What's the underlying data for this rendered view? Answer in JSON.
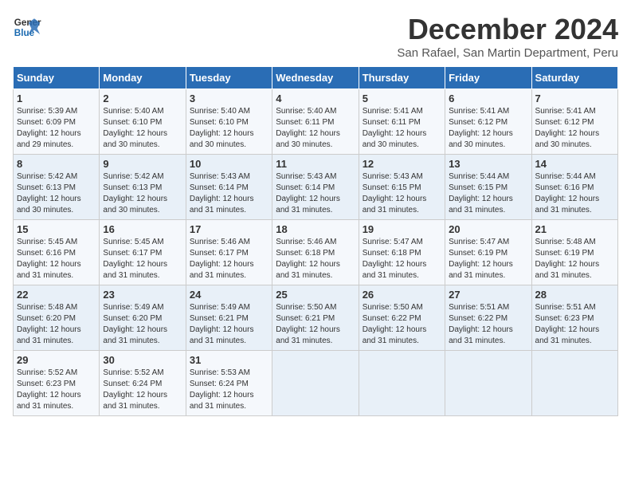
{
  "logo": {
    "line1": "General",
    "line2": "Blue"
  },
  "title": "December 2024",
  "location": "San Rafael, San Martin Department, Peru",
  "weekdays": [
    "Sunday",
    "Monday",
    "Tuesday",
    "Wednesday",
    "Thursday",
    "Friday",
    "Saturday"
  ],
  "weeks": [
    [
      {
        "day": "1",
        "sr": "5:39 AM",
        "ss": "6:09 PM",
        "dh": "12 hours and 29 minutes."
      },
      {
        "day": "2",
        "sr": "5:40 AM",
        "ss": "6:10 PM",
        "dh": "12 hours and 30 minutes."
      },
      {
        "day": "3",
        "sr": "5:40 AM",
        "ss": "6:10 PM",
        "dh": "12 hours and 30 minutes."
      },
      {
        "day": "4",
        "sr": "5:40 AM",
        "ss": "6:11 PM",
        "dh": "12 hours and 30 minutes."
      },
      {
        "day": "5",
        "sr": "5:41 AM",
        "ss": "6:11 PM",
        "dh": "12 hours and 30 minutes."
      },
      {
        "day": "6",
        "sr": "5:41 AM",
        "ss": "6:12 PM",
        "dh": "12 hours and 30 minutes."
      },
      {
        "day": "7",
        "sr": "5:41 AM",
        "ss": "6:12 PM",
        "dh": "12 hours and 30 minutes."
      }
    ],
    [
      {
        "day": "8",
        "sr": "5:42 AM",
        "ss": "6:13 PM",
        "dh": "12 hours and 30 minutes."
      },
      {
        "day": "9",
        "sr": "5:42 AM",
        "ss": "6:13 PM",
        "dh": "12 hours and 30 minutes."
      },
      {
        "day": "10",
        "sr": "5:43 AM",
        "ss": "6:14 PM",
        "dh": "12 hours and 31 minutes."
      },
      {
        "day": "11",
        "sr": "5:43 AM",
        "ss": "6:14 PM",
        "dh": "12 hours and 31 minutes."
      },
      {
        "day": "12",
        "sr": "5:43 AM",
        "ss": "6:15 PM",
        "dh": "12 hours and 31 minutes."
      },
      {
        "day": "13",
        "sr": "5:44 AM",
        "ss": "6:15 PM",
        "dh": "12 hours and 31 minutes."
      },
      {
        "day": "14",
        "sr": "5:44 AM",
        "ss": "6:16 PM",
        "dh": "12 hours and 31 minutes."
      }
    ],
    [
      {
        "day": "15",
        "sr": "5:45 AM",
        "ss": "6:16 PM",
        "dh": "12 hours and 31 minutes."
      },
      {
        "day": "16",
        "sr": "5:45 AM",
        "ss": "6:17 PM",
        "dh": "12 hours and 31 minutes."
      },
      {
        "day": "17",
        "sr": "5:46 AM",
        "ss": "6:17 PM",
        "dh": "12 hours and 31 minutes."
      },
      {
        "day": "18",
        "sr": "5:46 AM",
        "ss": "6:18 PM",
        "dh": "12 hours and 31 minutes."
      },
      {
        "day": "19",
        "sr": "5:47 AM",
        "ss": "6:18 PM",
        "dh": "12 hours and 31 minutes."
      },
      {
        "day": "20",
        "sr": "5:47 AM",
        "ss": "6:19 PM",
        "dh": "12 hours and 31 minutes."
      },
      {
        "day": "21",
        "sr": "5:48 AM",
        "ss": "6:19 PM",
        "dh": "12 hours and 31 minutes."
      }
    ],
    [
      {
        "day": "22",
        "sr": "5:48 AM",
        "ss": "6:20 PM",
        "dh": "12 hours and 31 minutes."
      },
      {
        "day": "23",
        "sr": "5:49 AM",
        "ss": "6:20 PM",
        "dh": "12 hours and 31 minutes."
      },
      {
        "day": "24",
        "sr": "5:49 AM",
        "ss": "6:21 PM",
        "dh": "12 hours and 31 minutes."
      },
      {
        "day": "25",
        "sr": "5:50 AM",
        "ss": "6:21 PM",
        "dh": "12 hours and 31 minutes."
      },
      {
        "day": "26",
        "sr": "5:50 AM",
        "ss": "6:22 PM",
        "dh": "12 hours and 31 minutes."
      },
      {
        "day": "27",
        "sr": "5:51 AM",
        "ss": "6:22 PM",
        "dh": "12 hours and 31 minutes."
      },
      {
        "day": "28",
        "sr": "5:51 AM",
        "ss": "6:23 PM",
        "dh": "12 hours and 31 minutes."
      }
    ],
    [
      {
        "day": "29",
        "sr": "5:52 AM",
        "ss": "6:23 PM",
        "dh": "12 hours and 31 minutes."
      },
      {
        "day": "30",
        "sr": "5:52 AM",
        "ss": "6:24 PM",
        "dh": "12 hours and 31 minutes."
      },
      {
        "day": "31",
        "sr": "5:53 AM",
        "ss": "6:24 PM",
        "dh": "12 hours and 31 minutes."
      },
      null,
      null,
      null,
      null
    ]
  ],
  "labels": {
    "sunrise": "Sunrise:",
    "sunset": "Sunset:",
    "daylight": "Daylight:"
  }
}
